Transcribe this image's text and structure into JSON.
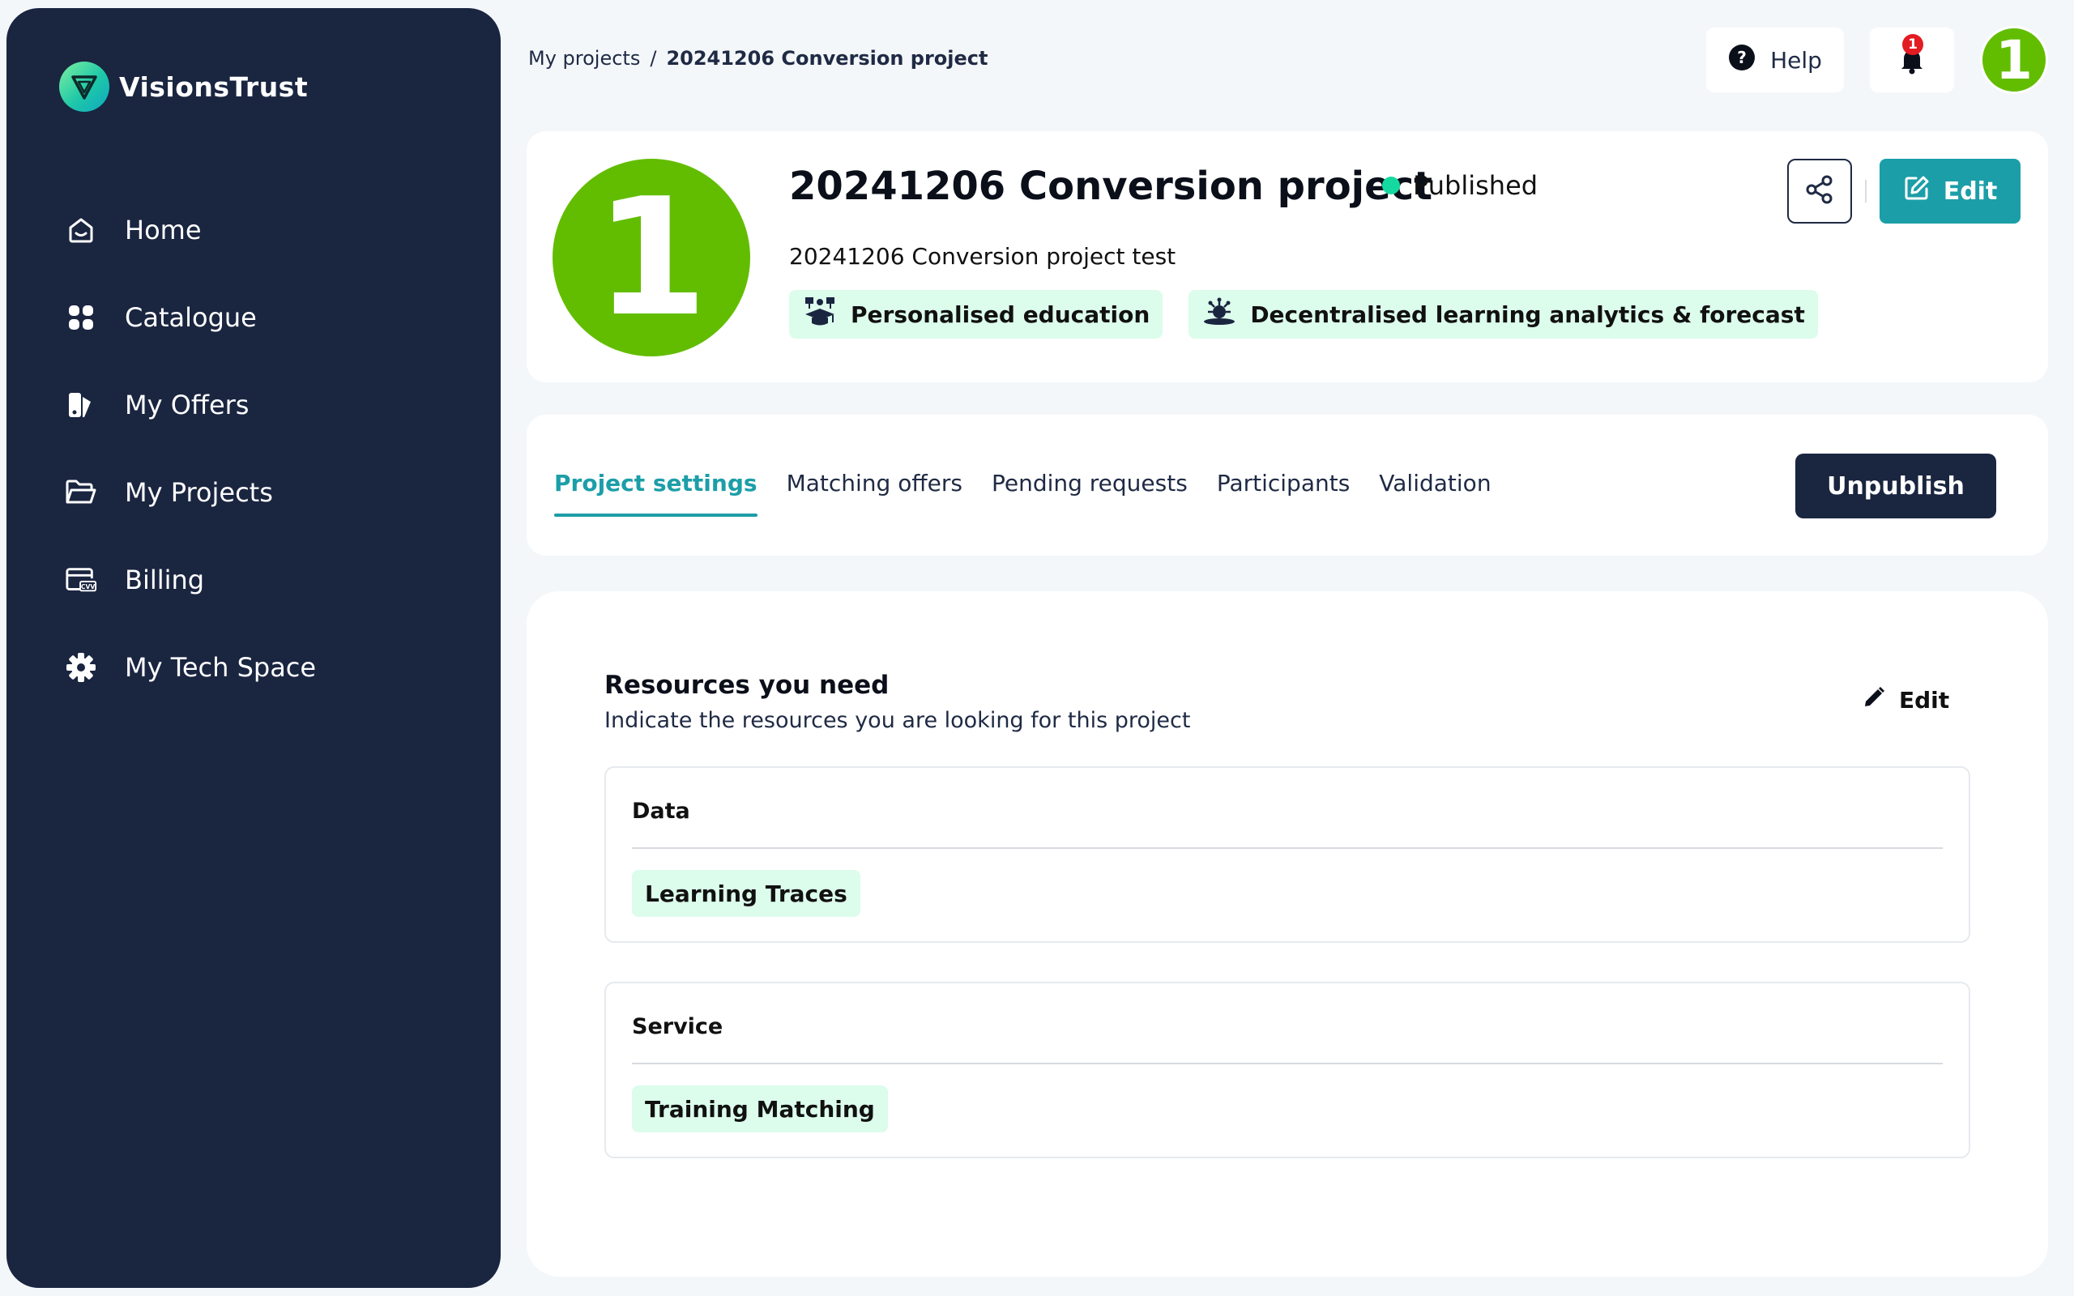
{
  "brand": {
    "name": "VisionsTrust"
  },
  "sidebar": {
    "items": [
      {
        "label": "Home",
        "icon": "home-icon"
      },
      {
        "label": "Catalogue",
        "icon": "grid-icon"
      },
      {
        "label": "My Offers",
        "icon": "offers-icon"
      },
      {
        "label": "My Projects",
        "icon": "folder-icon"
      },
      {
        "label": "Billing",
        "icon": "credit-card-icon"
      },
      {
        "label": "My Tech Space",
        "icon": "gear-icon"
      }
    ]
  },
  "breadcrumb": {
    "root": "My projects",
    "separator": "/",
    "current": "20241206 Conversion project"
  },
  "topbar": {
    "help_label": "Help",
    "notification_count": "1",
    "avatar_text": "1"
  },
  "project": {
    "avatar_text": "1",
    "title": "20241206 Conversion project",
    "status": "Published",
    "description": "20241206 Conversion project test",
    "tags": [
      {
        "label": "Personalised education",
        "icon": "education-icon"
      },
      {
        "label": "Decentralised learning analytics & forecast",
        "icon": "analytics-icon"
      }
    ],
    "edit_label": "Edit"
  },
  "tabs": {
    "items": [
      "Project settings",
      "Matching offers",
      "Pending requests",
      "Participants",
      "Validation"
    ],
    "active": "Project settings",
    "unpublish_label": "Unpublish"
  },
  "resources": {
    "title": "Resources you need",
    "subtitle": "Indicate the resources you are looking for this project",
    "edit_label": "Edit",
    "groups": [
      {
        "name": "Data",
        "items": [
          "Learning Traces"
        ]
      },
      {
        "name": "Service",
        "items": [
          "Training Matching"
        ]
      }
    ]
  },
  "colors": {
    "sidebar_bg": "#1a2540",
    "accent": "#1c9ea8",
    "avatar_green": "#62bd00",
    "tag_bg": "#dcfcec",
    "status_dot": "#14d9a0",
    "badge_red": "#e31b23"
  }
}
